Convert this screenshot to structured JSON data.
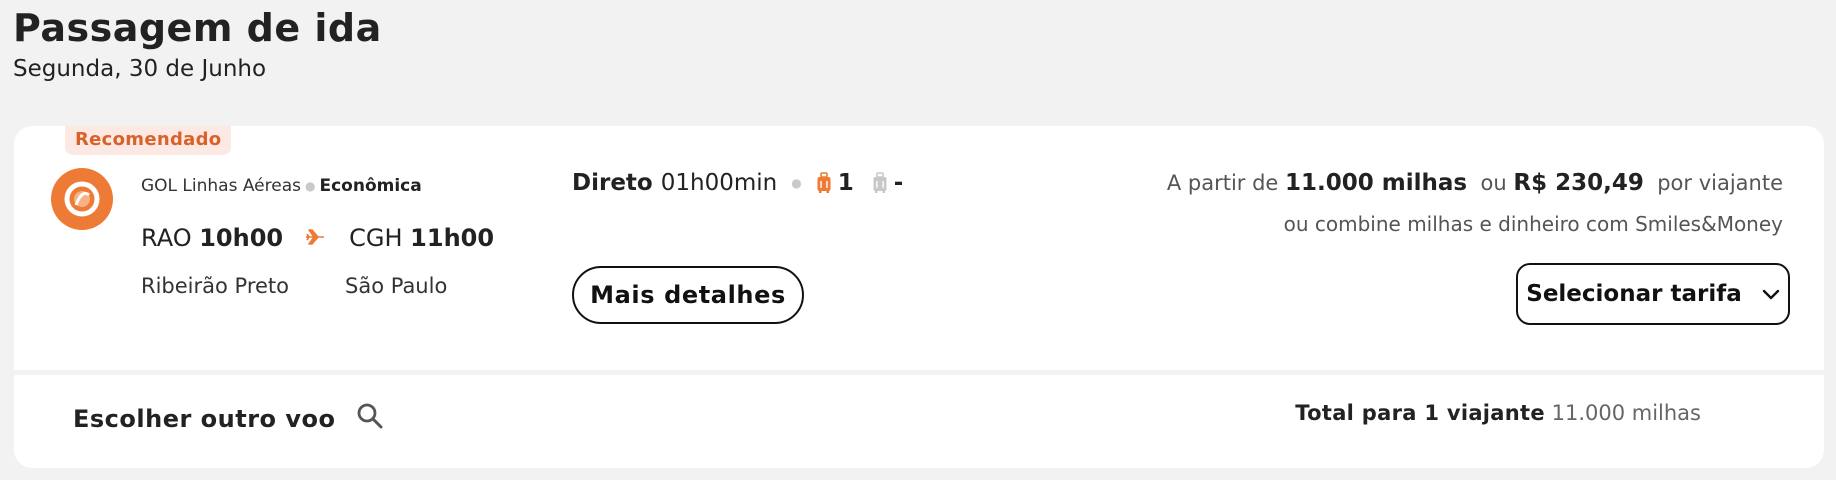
{
  "header": {
    "title": "Passagem de ida",
    "subtitle": "Segunda, 30 de Junho"
  },
  "flight": {
    "badge": "Recomendado",
    "airline": "GOL Linhas Aéreas",
    "cabin": "Econômica",
    "origin_code": "RAO",
    "origin_time": "10h00",
    "dest_code": "CGH",
    "dest_time": "11h00",
    "origin_city": "Ribeirão Preto",
    "dest_city": "São Paulo",
    "stops": "Direto",
    "duration": "01h00min",
    "carry_on_count": "1",
    "checked_bag_count": "-",
    "details_label": "Mais detalhes",
    "price_prefix": "A partir de",
    "miles": "11.000 milhas",
    "price_or": "ou",
    "money": "R$ 230,49",
    "price_suffix": "por viajante",
    "combine_text": "ou combine milhas e dinheiro com Smiles&Money",
    "select_label": "Selecionar tarifa"
  },
  "footer": {
    "other_flight": "Escolher outro voo",
    "total_label": "Total para 1 viajante",
    "total_value": "11.000 milhas"
  },
  "colors": {
    "accent": "#ee7b35",
    "badge_bg": "#fde9e4",
    "badge_text": "#d9622a"
  },
  "icons": [
    "gol-logo-icon",
    "airplane-icon",
    "carry-on-bag-icon",
    "checked-bag-icon",
    "chevron-down-icon",
    "search-icon"
  ]
}
